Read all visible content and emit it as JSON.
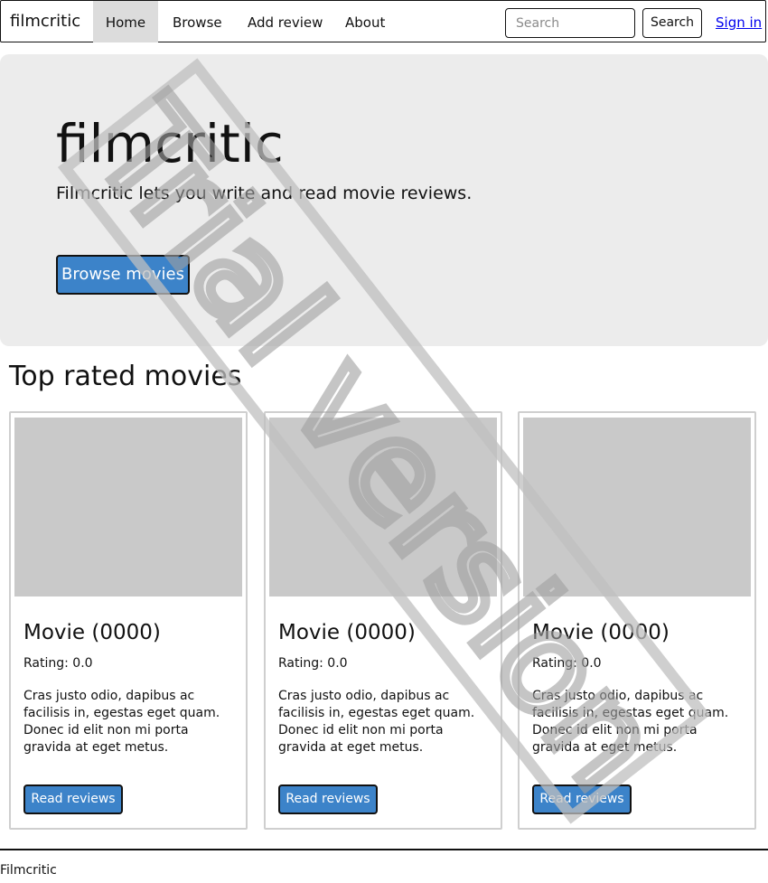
{
  "navbar": {
    "brand": "filmcritic",
    "items": [
      {
        "label": "Home",
        "active": true
      },
      {
        "label": "Browse",
        "active": false
      },
      {
        "label": "Add review",
        "active": false
      },
      {
        "label": "About",
        "active": false
      }
    ],
    "search_placeholder": "Search",
    "search_button": "Search",
    "signin": "Sign in"
  },
  "hero": {
    "title": "filmcritic",
    "subtitle": "Filmcritic lets you write and read movie reviews.",
    "button": "Browse movies"
  },
  "section_title": "Top rated movies",
  "cards": [
    {
      "title": "Movie (0000)",
      "rating": "Rating: 0.0",
      "text": "Cras justo odio, dapibus ac facilisis in, egestas eget quam. Donec id elit non mi porta gravida at eget metus.",
      "button": "Read reviews"
    },
    {
      "title": "Movie (0000)",
      "rating": "Rating: 0.0",
      "text": "Cras justo odio, dapibus ac facilisis in, egestas eget quam. Donec id elit non mi porta gravida at eget metus.",
      "button": "Read reviews"
    },
    {
      "title": "Movie (0000)",
      "rating": "Rating: 0.0",
      "text": "Cras justo odio, dapibus ac facilisis in, egestas eget quam. Donec id elit non mi porta gravida at eget metus.",
      "button": "Read reviews"
    }
  ],
  "footer": "Filmcritic",
  "watermark": "Trial version",
  "colors": {
    "primary_button": "#3c83c9",
    "hero_background": "#ececec",
    "image_placeholder": "#c9c9c9",
    "active_nav": "#dcdcdc",
    "link": "#0000ee"
  }
}
